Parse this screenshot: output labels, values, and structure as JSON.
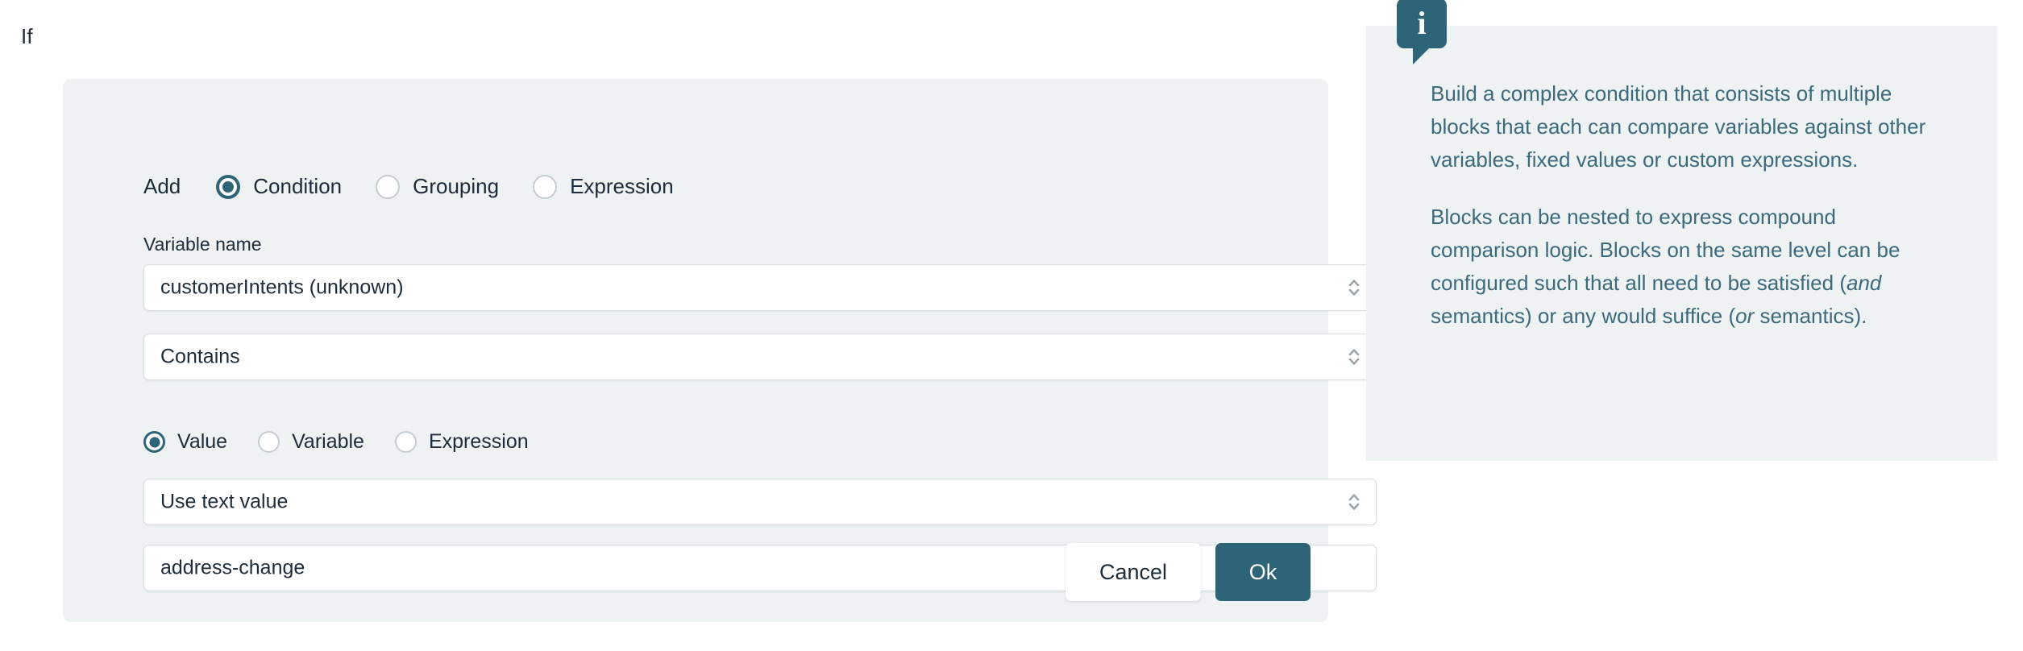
{
  "heading": {
    "if_label": "If"
  },
  "condition_form": {
    "add_label": "Add",
    "add_options": [
      {
        "label": "Condition",
        "selected": true
      },
      {
        "label": "Grouping",
        "selected": false
      },
      {
        "label": "Expression",
        "selected": false
      }
    ],
    "variable_name_label": "Variable name",
    "variable_select": {
      "value": "customerIntents (unknown)",
      "icon": "chevron-up-down-icon"
    },
    "operator_select": {
      "value": "Contains",
      "icon": "chevron-up-down-icon"
    },
    "comparison_options": [
      {
        "label": "Value",
        "selected": true
      },
      {
        "label": "Variable",
        "selected": false
      },
      {
        "label": "Expression",
        "selected": false
      }
    ],
    "value_mode_select": {
      "value": "Use text value",
      "icon": "chevron-up-down-icon"
    },
    "value_input": {
      "value": "address-change",
      "placeholder": ""
    },
    "buttons": {
      "cancel_label": "Cancel",
      "ok_label": "Ok"
    }
  },
  "info_panel": {
    "icon": "info-bubble-icon",
    "icon_glyph": "i",
    "paragraph_1": "Build a complex condition that consists of multiple blocks that each can compare variables against other variables, fixed values or custom expressions.",
    "paragraph_2_part_1": "Blocks can be nested to express compound comparison logic. Blocks on the same level can be configured such that all need to be satisfied (",
    "paragraph_2_em_1": "and",
    "paragraph_2_part_2": " semantics) or any would suffice (",
    "paragraph_2_em_2": "or",
    "paragraph_2_part_3": " semantics)."
  },
  "colors": {
    "accent": "#2d6478",
    "panel_bg": "#eef2f3",
    "text": "#1d2c3b",
    "info_text": "#3c6a7d",
    "control_border": "#d6dee2",
    "radio_off_border": "#c3cdd2"
  }
}
